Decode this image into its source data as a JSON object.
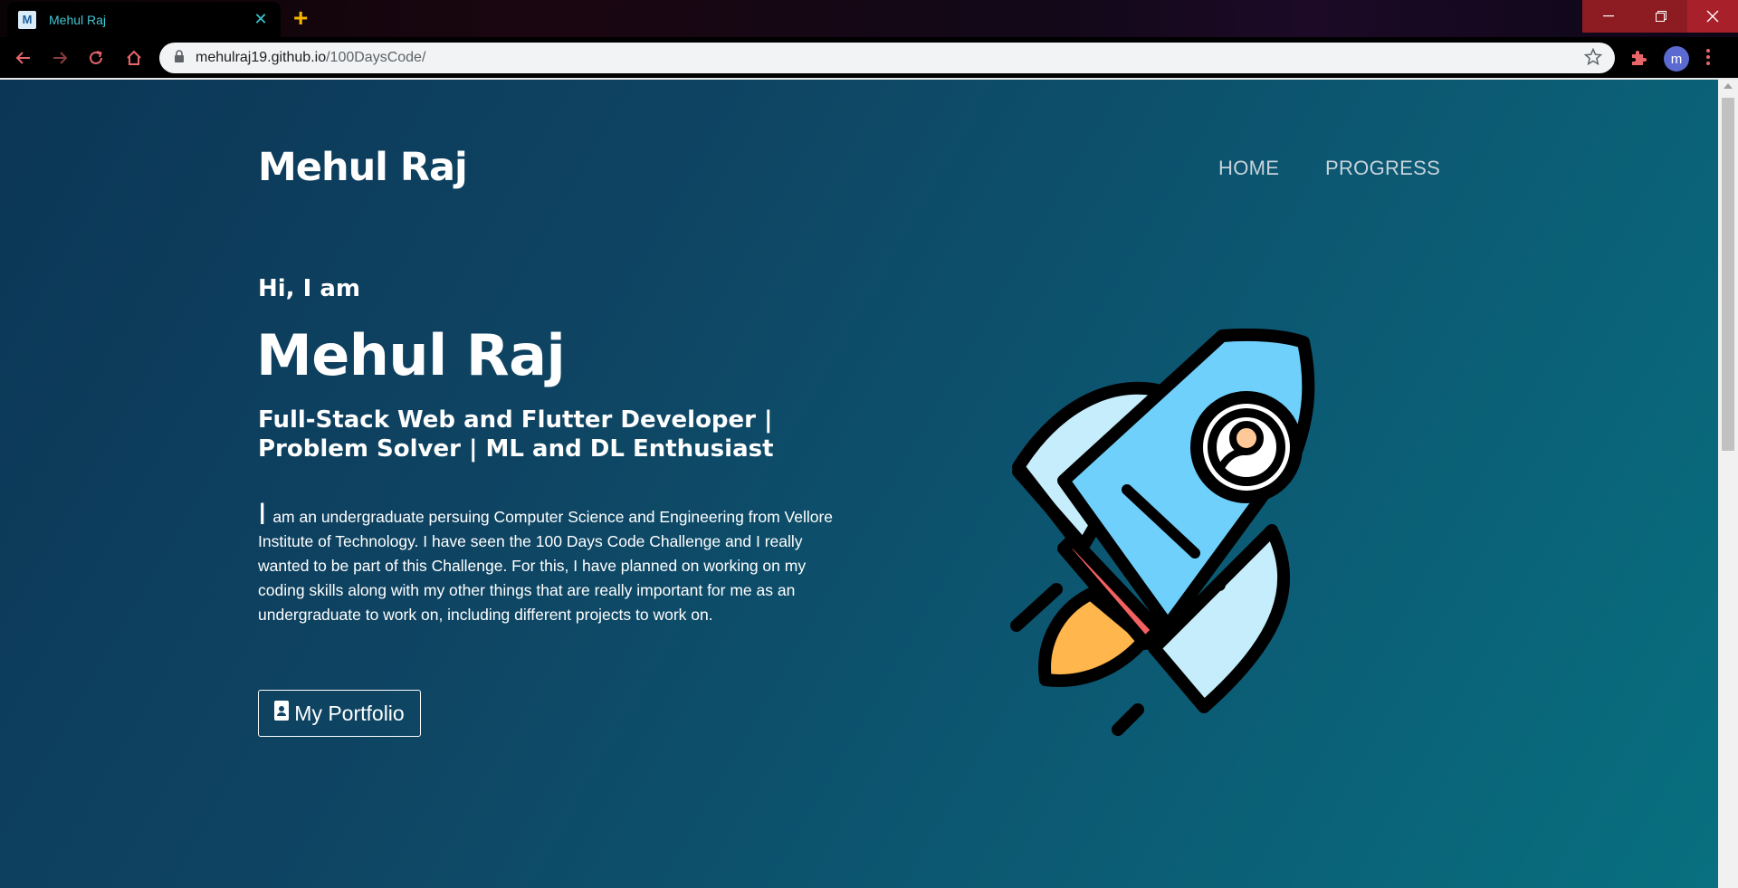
{
  "browser": {
    "tab": {
      "title": "Mehul Raj",
      "favicon_letter": "M"
    },
    "address_bar": {
      "host": "mehulraj19.github.io",
      "path": "/100DaysCode/"
    },
    "profile_initial": "m"
  },
  "site": {
    "logo": "Mehul Raj",
    "nav": {
      "home": "HOME",
      "progress": "PROGRESS"
    }
  },
  "hero": {
    "greeting": "Hi, I am",
    "name": "Mehul Raj",
    "headline_line1": "Full-Stack Web and Flutter Developer |",
    "headline_line2": "Problem Solver | ML and DL Enthusiast",
    "about_dropcap": "I",
    "about_text": "am an undergraduate persuing Computer Science and Engineering from Vellore Institute of Technology. I have seen the 100 Days Code Challenge and I really wanted to be part of this Challenge. For this, I have planned on working on my coding skills along with my other things that are really important for me as an undergraduate to work on, including different projects to work on.",
    "portfolio_button": "My Portfolio"
  },
  "colors": {
    "page_gradient_start": "#0c3656",
    "page_gradient_end": "#087080",
    "rocket_body": "#6fd0fb",
    "rocket_fin": "#c6edfb",
    "rocket_flame": "#ffb64c",
    "rocket_band": "#f46161",
    "rocket_window_face": "#ffc997"
  },
  "icons": {
    "rocket": "rocket-illustration",
    "portfolio": "id-badge-icon"
  }
}
